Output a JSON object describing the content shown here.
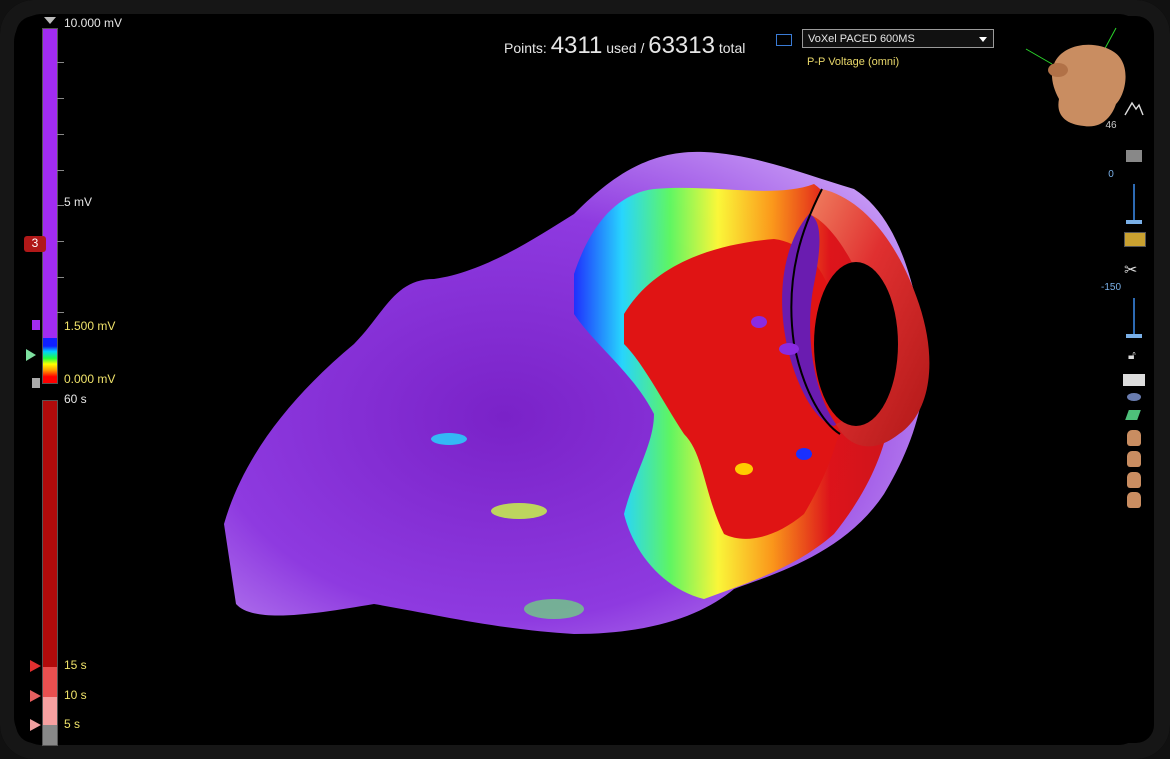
{
  "header": {
    "points_prefix": "Points:",
    "points_used": "4311",
    "points_used_label": "used /",
    "points_total": "63313",
    "points_total_label": "total",
    "map_selected": "VoXel PACED 600MS",
    "map_subtitle": "P-P Voltage (omni)"
  },
  "voltage_scale": {
    "top": "10.000 mV",
    "mid": "5 mV",
    "upper_threshold": "1.500 mV",
    "lower_threshold": "0.000 mV",
    "side_marker": "3"
  },
  "time_scale": {
    "top": "60 s",
    "t15": "15 s",
    "t10": "10 s",
    "t5": "5 s"
  },
  "toolbar": {
    "tilt_value": "46",
    "opacity_value": "0",
    "clip_value": "-150"
  },
  "colors": {
    "low_voltage": "#ff0000",
    "high_voltage": "#a12cf0",
    "accent": "#3a7bd5",
    "subtitle": "#e9d86a"
  }
}
